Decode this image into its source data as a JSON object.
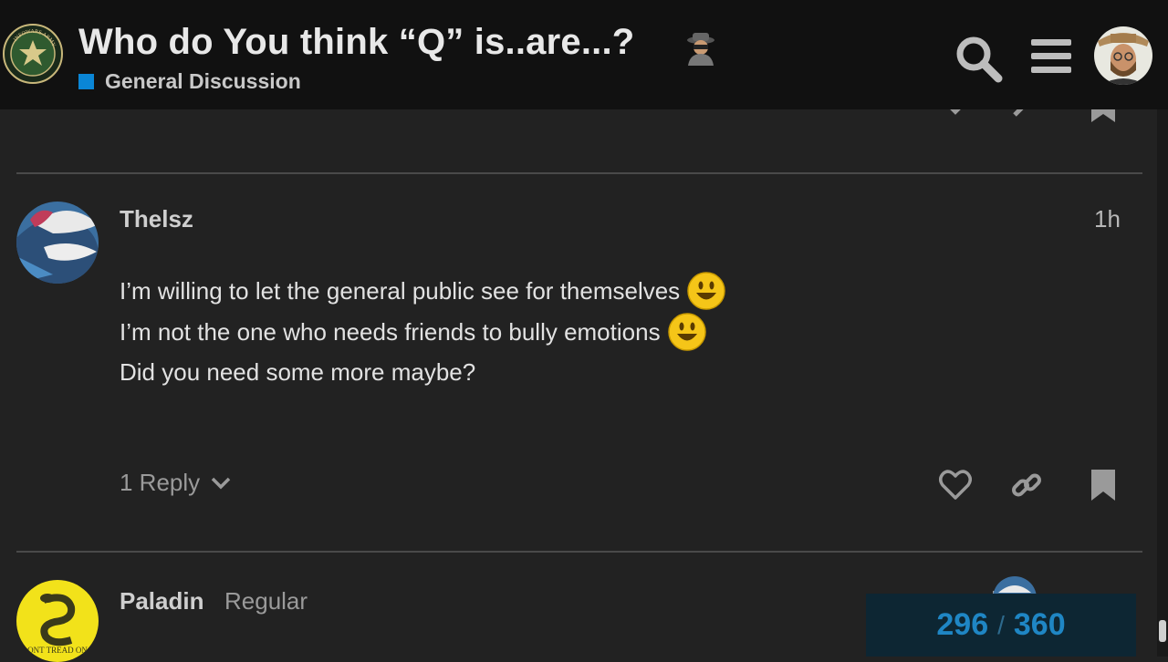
{
  "header": {
    "logo_ring_text": "INFOWARS ARMY",
    "topic_title": "Who do You think “Q” is..are...?",
    "title_emoji": "detective-emoji",
    "category": {
      "label": "General Discussion",
      "color": "#0a86d6"
    },
    "icons": [
      "search-icon",
      "menu-icon"
    ],
    "user_avatar": "user-avatar"
  },
  "posts": [
    {
      "username": "Thelsz",
      "date": "1h",
      "lines": [
        "I’m willing to let the general public see for themselves",
        "I’m not the one who needs friends to bully emotions",
        "Did you need some more maybe?"
      ],
      "line_emojis": [
        "smiley-emoji",
        "smiley-emoji",
        ""
      ],
      "reply_label": "1 Reply",
      "actions": [
        "like-icon",
        "link-icon",
        "bookmark-icon"
      ]
    },
    {
      "username": "Paladin",
      "user_title": "Regular",
      "avatar_text": "ONT TREAD ON"
    }
  ],
  "timeline": {
    "current": "296",
    "separator": "/",
    "total": "360"
  },
  "colors": {
    "background": "#222222",
    "header": "#111111",
    "accent": "#0a86d6",
    "divider": "#4a4a4a"
  }
}
